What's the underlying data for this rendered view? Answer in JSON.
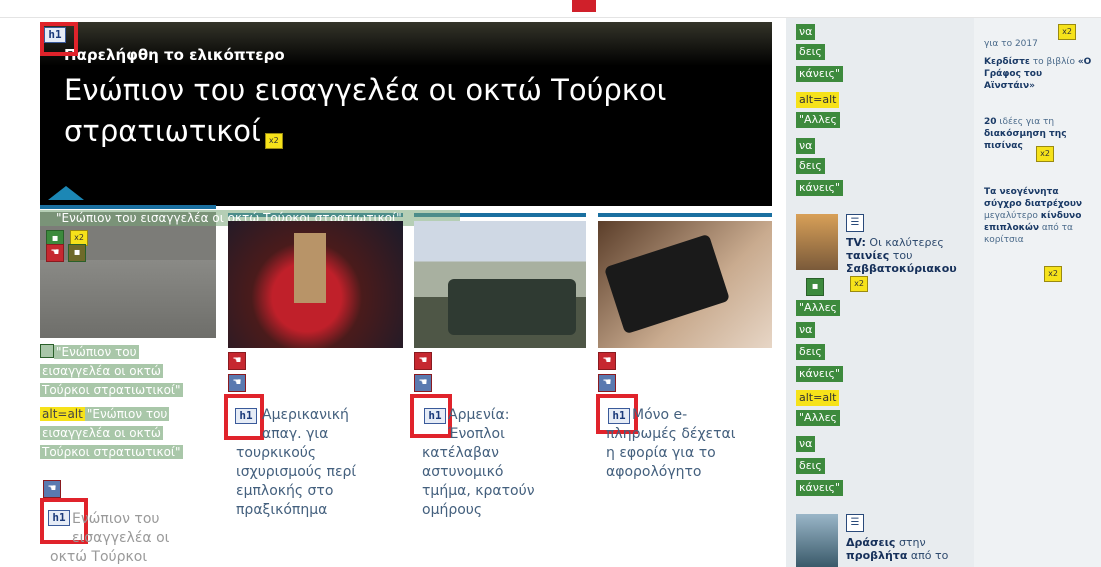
{
  "hero": {
    "kicker": "Παρελήφθη το ελικόπτερο",
    "title": "Ενώπιον του εισαγγελέα οι οκτώ Τούρκοι στρατιωτικοί"
  },
  "badges": {
    "h1": "h1",
    "alt": "alt=alt",
    "chip": "x2"
  },
  "column1": {
    "caption_overlay": "\"Ενώπιον του εισαγγελέα οι οκτώ Τούρκοι στρατιωτικοί\"",
    "alt_line1": "\"Ενώπιον του",
    "alt_line2": "εισαγγελέα οι οκτώ",
    "alt_line3": "Τούρκοι στρατιωτικοί\"",
    "alt2_line1": "\"Ενώπιον του",
    "alt2_line2": "εισαγγελέα οι οκτώ",
    "alt2_line3": "Τούρκοι στρατιωτικοί\"",
    "title_line1": "Ενώπιον του",
    "title_line2": "εισαγγελέα οι",
    "title_line3": "οκτώ Τούρκοι"
  },
  "articles": [
    {
      "title_lines": [
        "Αμερικανική",
        "απαγ. για",
        "τουρκικούς",
        "ισχυρισμούς περί",
        "εμπλοκής στο",
        "πραξικόπημα"
      ]
    },
    {
      "title_lines": [
        "Αρμενία:",
        "Ένοπλοι",
        "κατέλαβαν",
        "αστυνομικό",
        "τμήμα, κρατούν",
        "ομήρους"
      ]
    },
    {
      "title_lines": [
        "Μόνο e-",
        "πληρωμές δέχεται",
        "η εφορία για το",
        "αφορολόγητο"
      ]
    }
  ],
  "right_tags": [
    "να",
    "δεις",
    "κάνεις\"",
    "alt=alt",
    "\"Αλλες",
    "να",
    "δεις",
    "κάνεις\""
  ],
  "right_tags2": [
    "\"Αλλες",
    "να",
    "δεις",
    "κάνεις\"",
    "alt=alt",
    "\"Αλλες",
    "να",
    "δεις",
    "κάνεις\""
  ],
  "col3_item1": {
    "lead": "TV:",
    "text1": "Οι καλύτερες",
    "bold1": "ταινίες",
    "text2": "του",
    "bold2": "Σαββατοκύριακου"
  },
  "col3_item2": {
    "bold1": "Δράσεις",
    "text1": "στην",
    "bold2": "προβλήτα",
    "text2": "από το"
  },
  "col4": {
    "line_top": "για το 2017",
    "item1_bold": "Κερδίστε",
    "item1_text": "το βιβλίο",
    "item1_bold2": "«Ο Γράφος του Αϊνστάιν»",
    "item2_bold": "20",
    "item2_text": "ιδέες για τη",
    "item2_bold2": "διακόσμηση της",
    "item2_bold3": "πισίνας",
    "item3_bold": "Τα νεογέννητα σύγχρο διατρέχουν",
    "item3_text": "μεγαλύτερο",
    "item3_bold2": "κίνδυνο επιπλοκών",
    "item3_text2": "από τα",
    "item3_text3": "κορίτσια"
  }
}
